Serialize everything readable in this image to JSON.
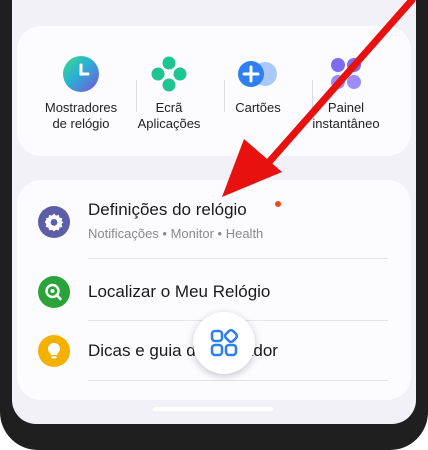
{
  "quick_apps": [
    {
      "label_line1": "Mostradores",
      "label_line2": "de relógio",
      "icon": "watch-face-icon"
    },
    {
      "label_line1": "Ecrã",
      "label_line2": "Aplicações",
      "icon": "apps-screen-icon"
    },
    {
      "label_line1": "Cartões",
      "label_line2": "",
      "icon": "tiles-icon"
    },
    {
      "label_line1": "Painel",
      "label_line2": "instantâneo",
      "icon": "quick-panel-icon"
    }
  ],
  "settings_list": [
    {
      "title": "Definições do relógio",
      "subtitle": "Notificações • Monitor • Health",
      "icon": "gear-icon",
      "icon_color": "#5c5fa8",
      "has_badge": true
    },
    {
      "title": "Localizar o Meu Relógio",
      "subtitle": "",
      "icon": "find-watch-icon",
      "icon_color": "#2aa43a"
    },
    {
      "title": "Dicas e guia do utilizador",
      "subtitle": "",
      "icon": "lightbulb-icon",
      "icon_color": "#f5b100"
    }
  ],
  "floating_button": {
    "icon": "apps-grid-icon"
  },
  "colors": {
    "accent": "#3f7de0",
    "annotation_arrow": "#e8110f",
    "badge": "#f04a1a"
  }
}
